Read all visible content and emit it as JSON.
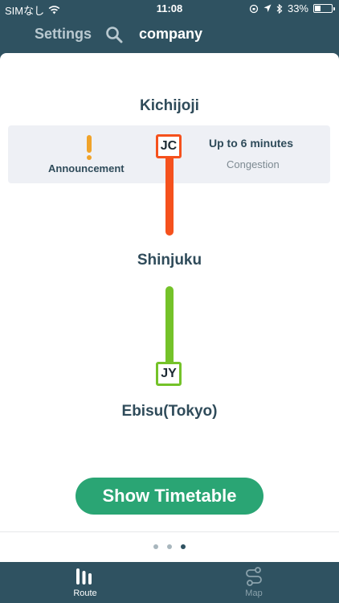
{
  "status_bar": {
    "carrier": "SIMなし",
    "time": "11:08",
    "battery": "33%",
    "battery_level": 0.33
  },
  "nav": {
    "back_label": "Settings",
    "title": "company"
  },
  "route": {
    "stations": [
      "Kichijoji",
      "Shinjuku",
      "Ebisu(Tokyo)"
    ],
    "segments": [
      {
        "code": "JC",
        "color": "#f5511d"
      },
      {
        "code": "JY",
        "color": "#74c229"
      }
    ]
  },
  "alert": {
    "announcement_label": "Announcement",
    "delay_text": "Up to 6 minutes",
    "congestion_label": "Congestion"
  },
  "actions": {
    "timetable_label": "Show Timetable"
  },
  "pager": {
    "count": 3,
    "active": 2
  },
  "tabs": [
    {
      "label": "Route",
      "icon": "route-icon"
    },
    {
      "label": "Map",
      "icon": "map-icon"
    }
  ],
  "colors": {
    "primary": "#2f5261",
    "accent": "#2aa574",
    "warning": "#f0a32a"
  }
}
